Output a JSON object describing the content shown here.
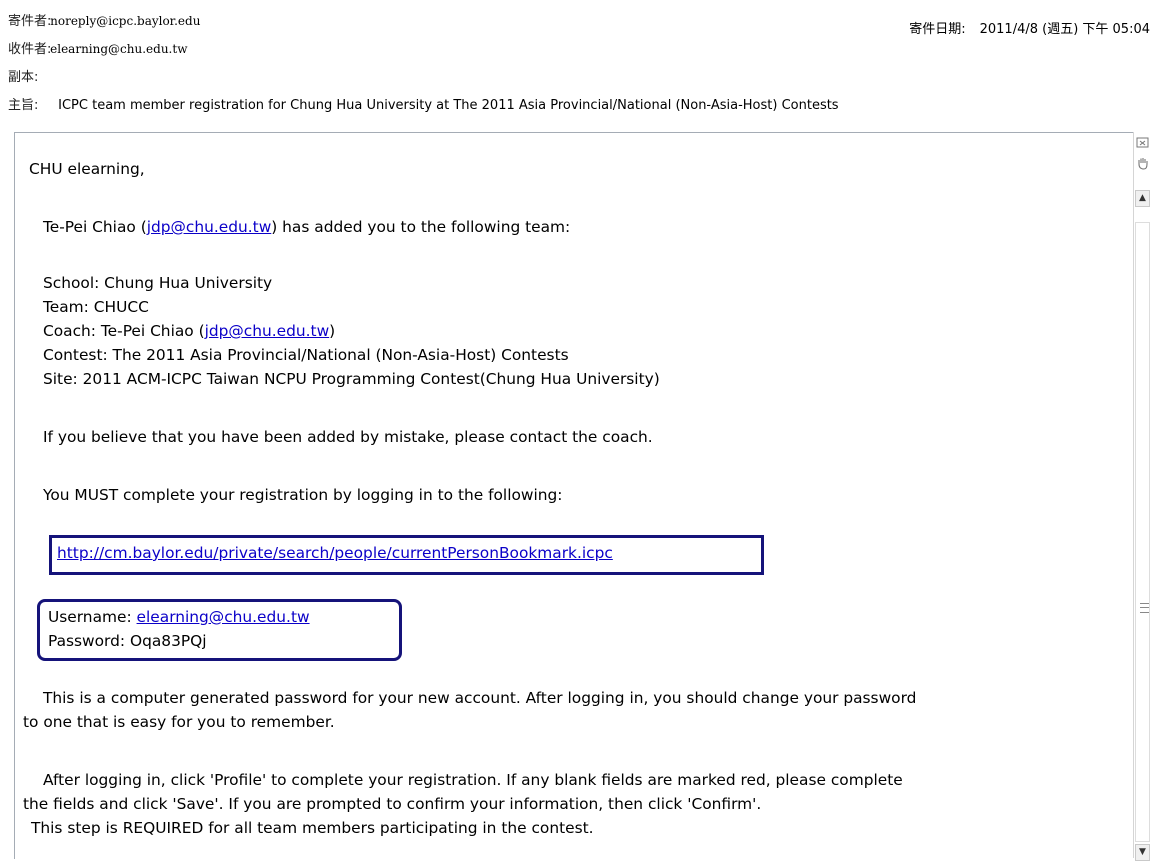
{
  "header": {
    "from_label": "寄件者:",
    "from_value": "noreply@icpc.baylor.edu",
    "date_label": "寄件日期:",
    "date_value": "2011/4/8 (週五) 下午 05:04",
    "to_label": "收件者:",
    "to_value": "elearning@chu.edu.tw",
    "cc_label": "副本:",
    "subject_label": "主旨:",
    "subject_value": "ICPC team member registration for Chung Hua University at The 2011 Asia Provincial/National (Non-Asia-Host) Contests"
  },
  "body": {
    "greeting": "CHU elearning,",
    "added_pre": "Te-Pei Chiao (",
    "added_link": "jdp@chu.edu.tw",
    "added_post": ") has added you to the following team:",
    "school": "School: Chung Hua University",
    "team": "Team: CHUCC",
    "coach_pre": "Coach: Te-Pei Chiao (",
    "coach_link": "jdp@chu.edu.tw",
    "coach_post": ")",
    "contest": "Contest: The 2011 Asia Provincial/National (Non-Asia-Host) Contests",
    "site": "Site: 2011 ACM-ICPC Taiwan NCPU Programming Contest(Chung Hua University)",
    "mistake": "If you believe that you have been added by mistake, please contact the coach.",
    "must": "You MUST complete your registration by logging in to the following:",
    "url": "http://cm.baylor.edu/private/search/people/currentPersonBookmark.icpc",
    "username_label": "Username: ",
    "username_link": "elearning@chu.edu.tw",
    "password": "Password: Oqa83PQj",
    "computer_1": "This is a computer generated password for your new account. After logging in, you should change your password",
    "computer_2": "to one that is easy for you to remember.",
    "profile_1": "After logging in, click 'Profile' to complete your registration. If any blank fields are marked red, please complete",
    "profile_2": "the fields and click 'Save'. If you are prompted to confirm your information, then click 'Confirm'.",
    "required": "This step is REQUIRED for all team members participating in the contest."
  },
  "scrollbar": {
    "icons": [
      "close-pane-icon",
      "hand-icon",
      "scroll-up-icon",
      "scroll-down-icon"
    ]
  }
}
